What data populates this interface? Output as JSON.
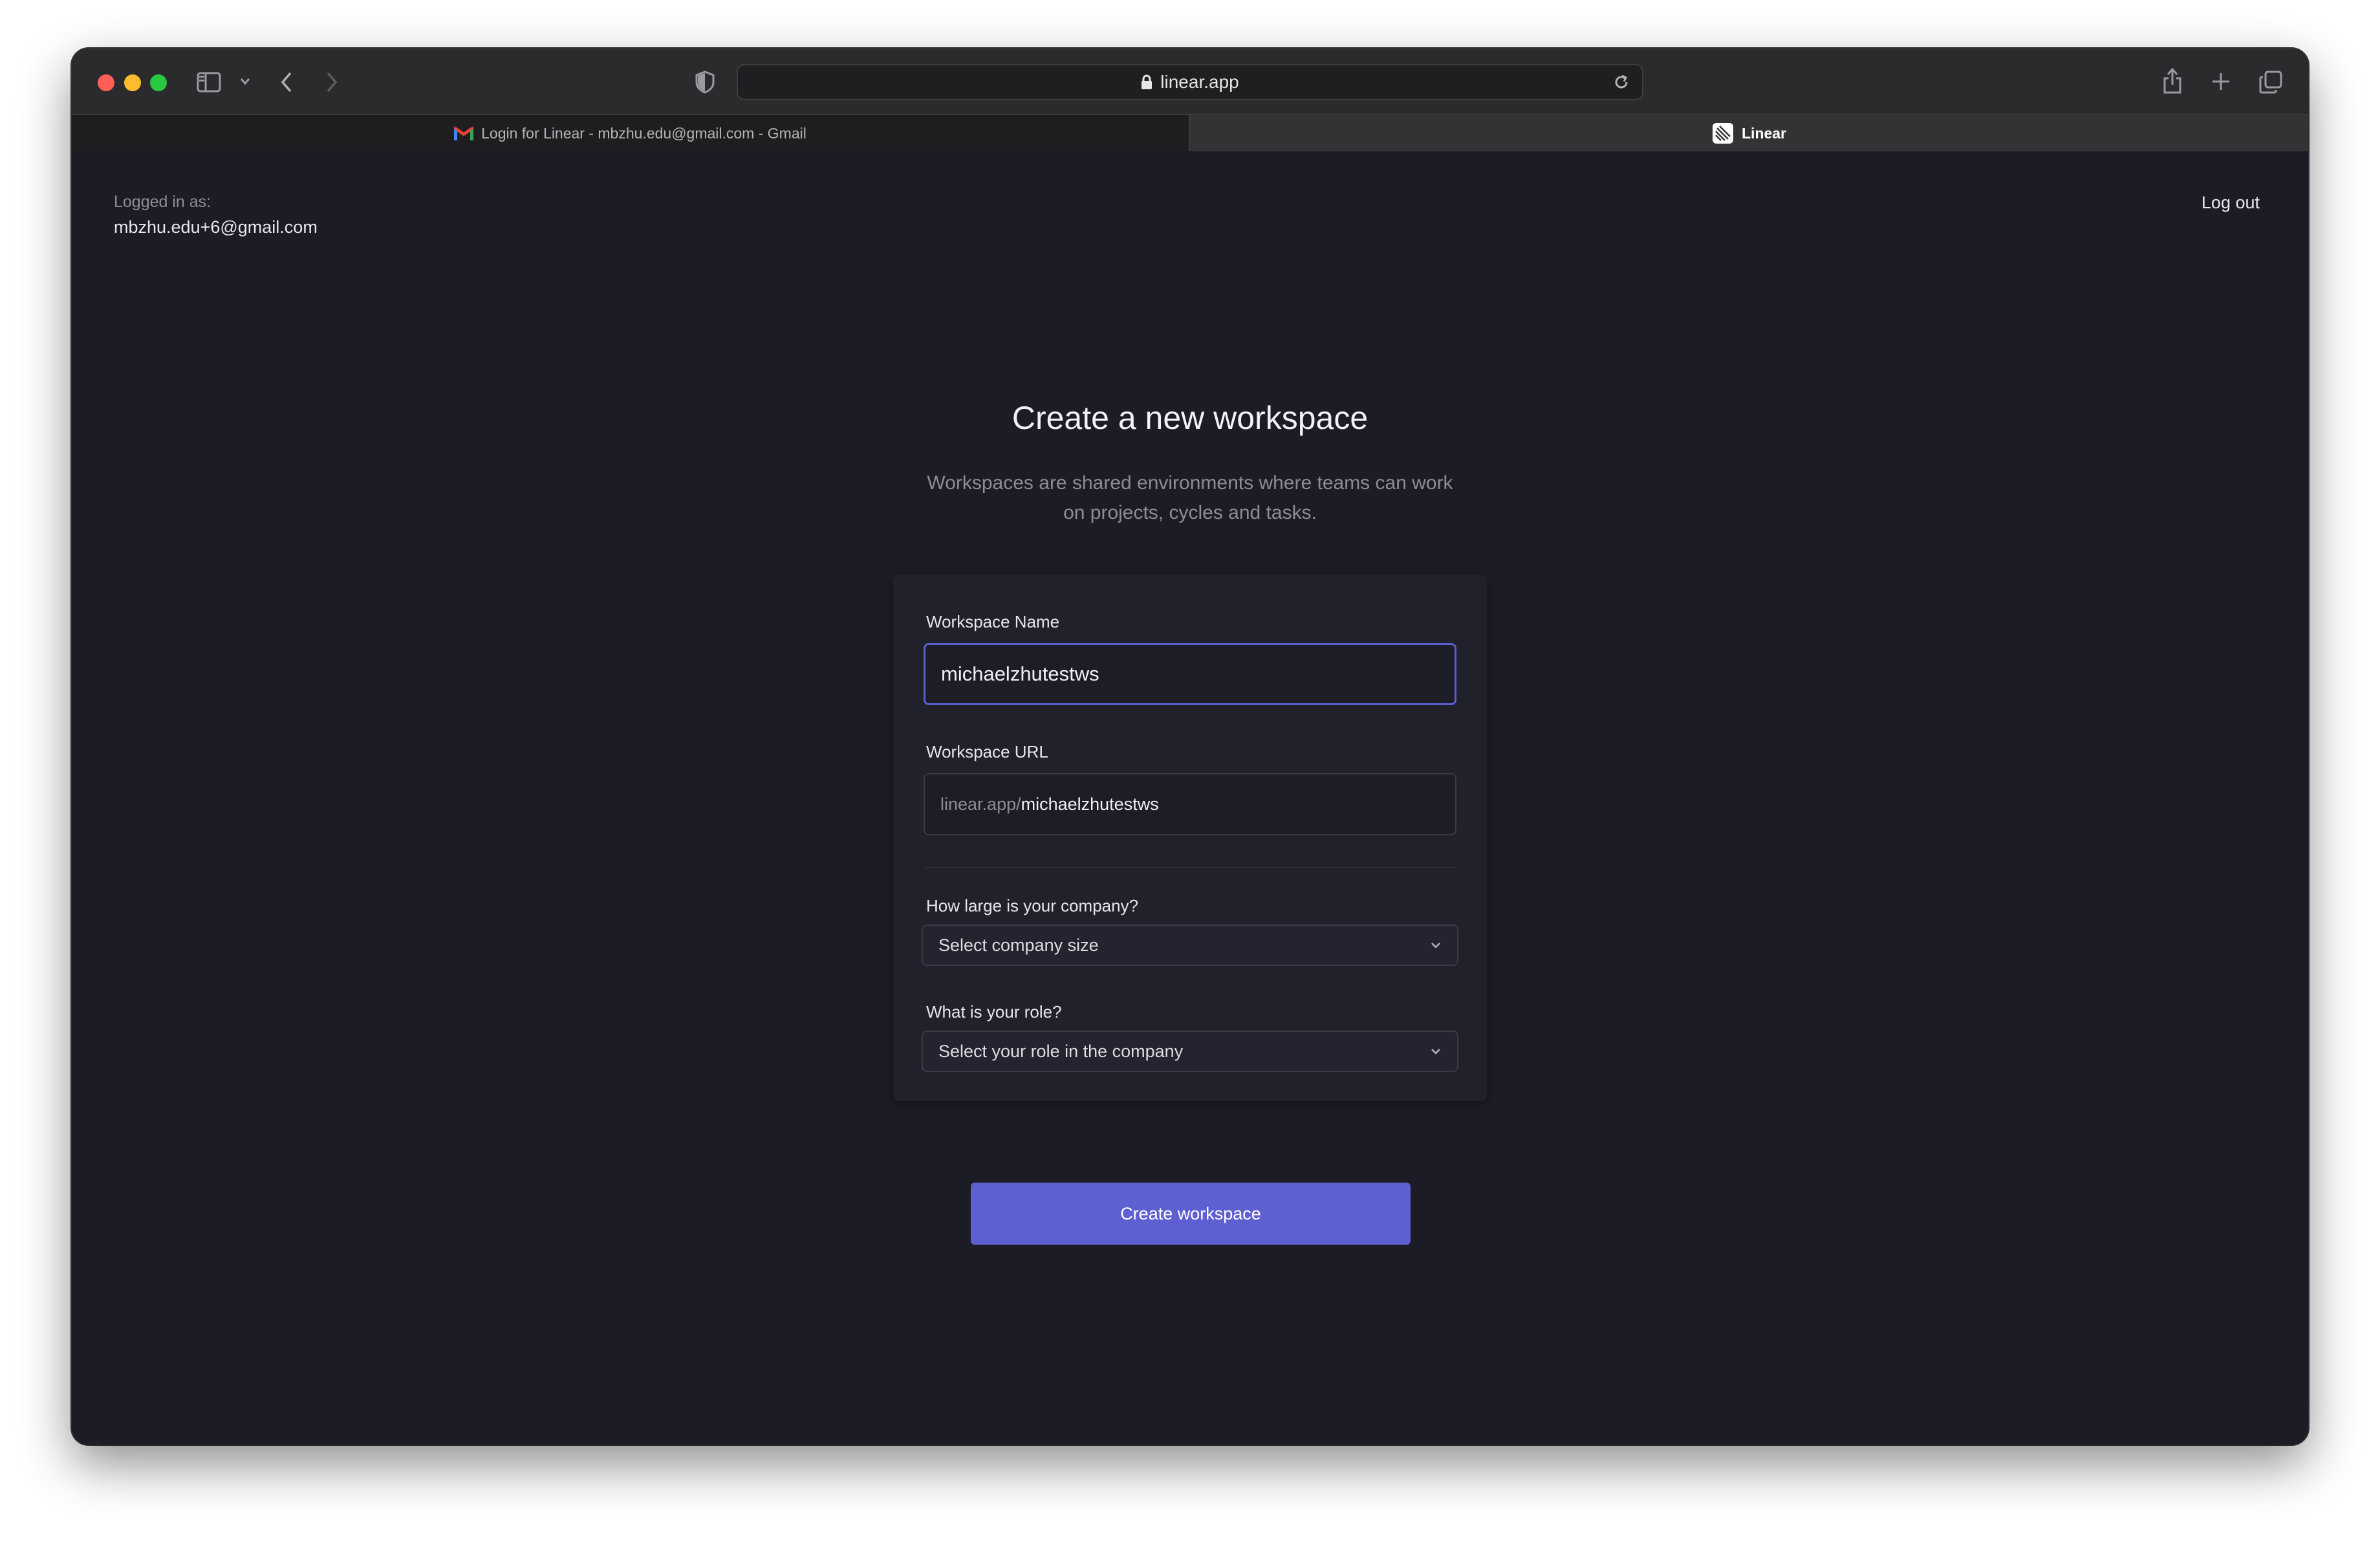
{
  "browser": {
    "url": "linear.app",
    "tabs": [
      {
        "label": "Login for Linear - mbzhu.edu@gmail.com - Gmail"
      },
      {
        "label": "Linear"
      }
    ]
  },
  "header": {
    "logged_in_label": "Logged in as:",
    "email": "mbzhu.edu+6@gmail.com",
    "logout": "Log out"
  },
  "main": {
    "title": "Create a new workspace",
    "subtitle_line1": "Workspaces are shared environments where teams can work",
    "subtitle_line2": "on projects, cycles and tasks."
  },
  "form": {
    "workspace_name_label": "Workspace Name",
    "workspace_name_value": "michaelzhutestws",
    "workspace_url_label": "Workspace URL",
    "workspace_url_prefix": "linear.app/",
    "workspace_url_value": "michaelzhutestws",
    "company_size_label": "How large is your company?",
    "company_size_placeholder": "Select company size",
    "role_label": "What is your role?",
    "role_placeholder": "Select your role in the company",
    "submit": "Create workspace"
  },
  "colors": {
    "accent": "#5e5fd0",
    "background": "#1b1c25",
    "card": "#20212b"
  }
}
